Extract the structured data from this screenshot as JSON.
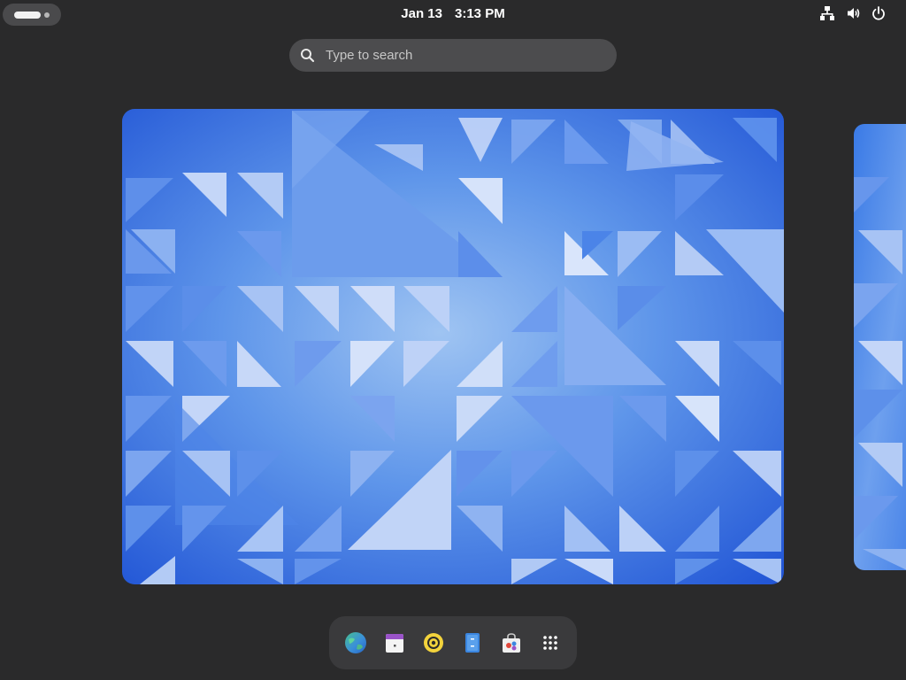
{
  "topbar": {
    "date": "Jan 13",
    "time": "3:13 PM"
  },
  "search": {
    "placeholder": "Type to search"
  },
  "dash": {
    "items": [
      {
        "name": "web-browser",
        "icon": "globe-icon"
      },
      {
        "name": "calendar",
        "icon": "calendar-icon"
      },
      {
        "name": "music-player",
        "icon": "disc-icon"
      },
      {
        "name": "file-manager",
        "icon": "files-icon"
      },
      {
        "name": "software-store",
        "icon": "shopping-bag-icon"
      },
      {
        "name": "show-apps",
        "icon": "app-grid-icon"
      }
    ]
  }
}
